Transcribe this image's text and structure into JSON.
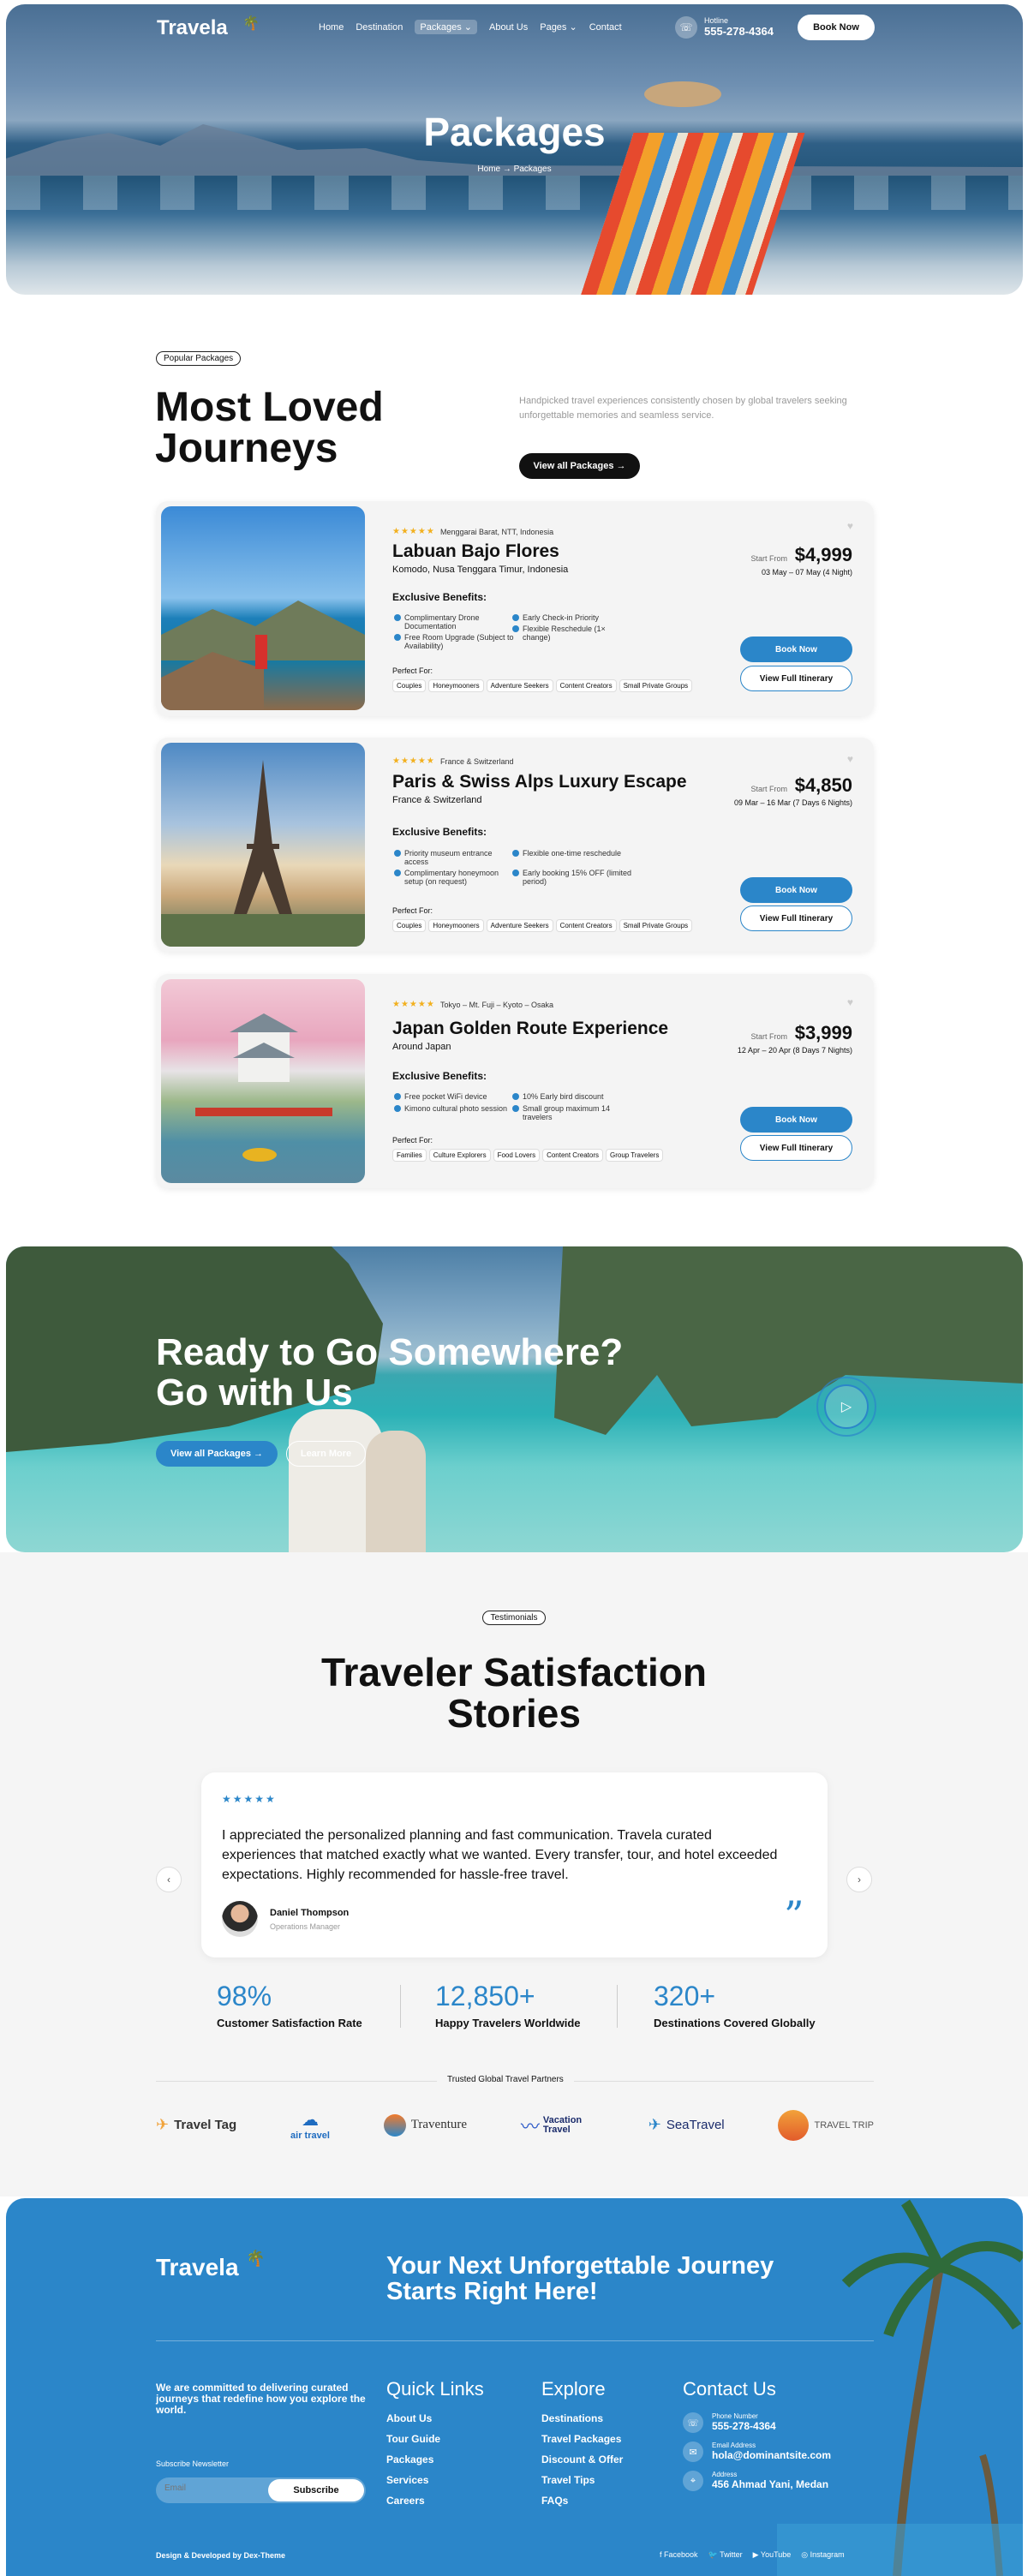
{
  "header": {
    "logo": "Travela",
    "nav": [
      "Home",
      "Destination",
      "Packages",
      "About Us",
      "Pages",
      "Contact"
    ],
    "hotline_label": "Hotline",
    "hotline_number": "555-278-4364",
    "book_now": "Book Now"
  },
  "hero": {
    "title": "Packages",
    "breadcrumb_home": "Home",
    "breadcrumb_sep": " → ",
    "breadcrumb_current": "Packages"
  },
  "popular": {
    "badge": "Popular Packages",
    "title_line1": "Most Loved",
    "title_line2": "Journeys",
    "description": "Handpicked travel experiences consistently chosen by global travelers seeking unforgettable memories and seamless service.",
    "view_all": "View all Packages"
  },
  "packages": [
    {
      "rating": "★★★★★",
      "location": "Menggarai Barat, NTT, Indonesia",
      "title": "Labuan Bajo Flores",
      "subtitle": "Komodo, Nusa Tenggara Timur, Indonesia",
      "benefits_label": "Exclusive Benefits:",
      "benefits": [
        "Complimentary Drone Documentation",
        "Free Room Upgrade (Subject to Availability)",
        "Early Check-in Priority",
        "Flexible Reschedule (1× change)"
      ],
      "perfect_for_label": "Perfect For:",
      "tags": [
        "Couples",
        "Honeymooners",
        "Adventure Seekers",
        "Content Creators",
        "Small Private Groups"
      ],
      "start_from": "Start From",
      "price": "$4,999",
      "dates": "03 May – 07 May (4 Night)",
      "book": "Book Now",
      "itinerary": "View Full Itinerary"
    },
    {
      "rating": "★★★★★",
      "location": "France & Switzerland",
      "title": "Paris & Swiss Alps Luxury Escape",
      "subtitle": "France & Switzerland",
      "benefits_label": "Exclusive Benefits:",
      "benefits": [
        "Priority museum entrance access",
        "Complimentary honeymoon setup (on request)",
        "Flexible one-time reschedule",
        "Early booking 15% OFF (limited period)"
      ],
      "perfect_for_label": "Perfect For:",
      "tags": [
        "Couples",
        "Honeymooners",
        "Adventure Seekers",
        "Content Creators",
        "Small Private Groups"
      ],
      "start_from": "Start From",
      "price": "$4,850",
      "dates": "09 Mar – 16 Mar (7 Days 6 Nights)",
      "book": "Book Now",
      "itinerary": "View Full Itinerary"
    },
    {
      "rating": "★★★★★",
      "location": "Tokyo – Mt. Fuji – Kyoto – Osaka",
      "title": "Japan Golden Route Experience",
      "subtitle": "Around Japan",
      "benefits_label": "Exclusive Benefits:",
      "benefits": [
        "Free pocket WiFi device",
        "Kimono cultural photo session",
        "10% Early bird discount",
        "Small group maximum 14 travelers"
      ],
      "perfect_for_label": "Perfect For:",
      "tags": [
        "Families",
        "Culture Explorers",
        "Food Lovers",
        "Content Creators",
        "Group Travelers"
      ],
      "start_from": "Start From",
      "price": "$3,999",
      "dates": "12 Apr – 20 Apr (8 Days 7 Nights)",
      "book": "Book Now",
      "itinerary": "View Full Itinerary"
    }
  ],
  "cta": {
    "title_line1": "Ready to Go Somewhere?",
    "title_line2": "Go with Us",
    "view_all": "View all Packages",
    "learn_more": "Learn More"
  },
  "testimonials": {
    "badge": "Testimonials",
    "title_line1": "Traveler Satisfaction",
    "title_line2": "Stories",
    "rating": "★★★★★",
    "quote": "I appreciated the personalized planning and fast communication. Travela curated experiences that matched exactly what we wanted. Every transfer, tour, and hotel exceeded expectations. Highly recommended for hassle-free travel.",
    "author": "Daniel Thompson",
    "role": "Operations Manager",
    "stats": [
      {
        "value": "98%",
        "label": "Customer Satisfaction Rate"
      },
      {
        "value": "12,850+",
        "label": "Happy Travelers Worldwide"
      },
      {
        "value": "320+",
        "label": "Destinations Covered Globally"
      }
    ],
    "partners_label": "Trusted Global Travel Partners",
    "partners": [
      "Travel Tag",
      "air travel",
      "Traventure",
      "Vacation Travel",
      "SeaTravel",
      "TRAVEL TRIP"
    ]
  },
  "footer": {
    "logo": "Travela",
    "headline_line1": "Your Next Unforgettable Journey",
    "headline_line2": "Starts Right Here!",
    "about": "We are committed to delivering curated journeys that redefine how you explore the world.",
    "subscribe_label": "Subscribe Newsletter",
    "email_placeholder": "Email",
    "subscribe_button": "Subscribe",
    "quick_links_title": "Quick Links",
    "quick_links": [
      "About Us",
      "Tour Guide",
      "Packages",
      "Services",
      "Careers"
    ],
    "explore_title": "Explore",
    "explore": [
      "Destinations",
      "Travel Packages",
      "Discount & Offer",
      "Travel Tips",
      "FAQs"
    ],
    "contact_title": "Contact Us",
    "phone_label": "Phone Number",
    "phone": "555-278-4364",
    "email_label": "Email Address",
    "email": "hola@dominantsite.com",
    "address_label": "Address",
    "address": "456 Ahmad Yani, Medan",
    "credit": "Design & Developed by Dex-Theme",
    "social": [
      "Facebook",
      "Twitter",
      "YouTube",
      "Instagram"
    ]
  },
  "colors": {
    "accent": "#2b86c9",
    "dark": "#111111",
    "card_bg": "#f4f4f4",
    "star": "#f2b01e"
  }
}
